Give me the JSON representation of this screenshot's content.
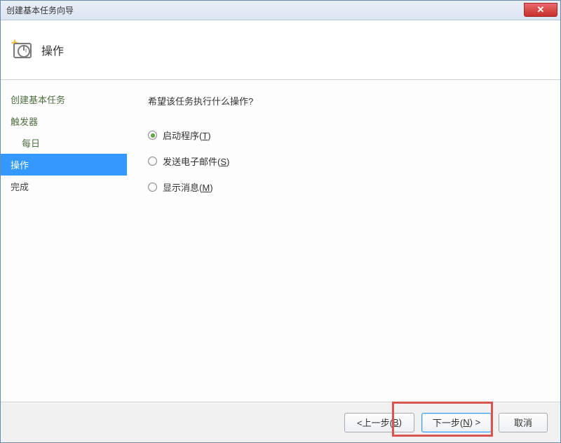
{
  "window": {
    "title": "创建基本任务向导",
    "close_symbol": "✕"
  },
  "header": {
    "title": "操作"
  },
  "sidebar": {
    "items": [
      {
        "label": "创建基本任务",
        "active": false,
        "sub": false
      },
      {
        "label": "触发器",
        "active": false,
        "sub": false
      },
      {
        "label": "每日",
        "active": false,
        "sub": true
      },
      {
        "label": "操作",
        "active": true,
        "sub": false
      },
      {
        "label": "完成",
        "active": false,
        "sub": false
      }
    ]
  },
  "main": {
    "question": "希望该任务执行什么操作?",
    "options": [
      {
        "label_prefix": "启动程序(",
        "accel": "T",
        "label_suffix": ")",
        "checked": true
      },
      {
        "label_prefix": "发送电子邮件(",
        "accel": "S",
        "label_suffix": ")",
        "checked": false
      },
      {
        "label_prefix": "显示消息(",
        "accel": "M",
        "label_suffix": ")",
        "checked": false
      }
    ]
  },
  "footer": {
    "back_prefix": "<上一步(",
    "back_accel": "B",
    "back_suffix": ")",
    "next_prefix": "下一步(",
    "next_accel": "N",
    "next_suffix": ") >",
    "cancel": "取消"
  }
}
